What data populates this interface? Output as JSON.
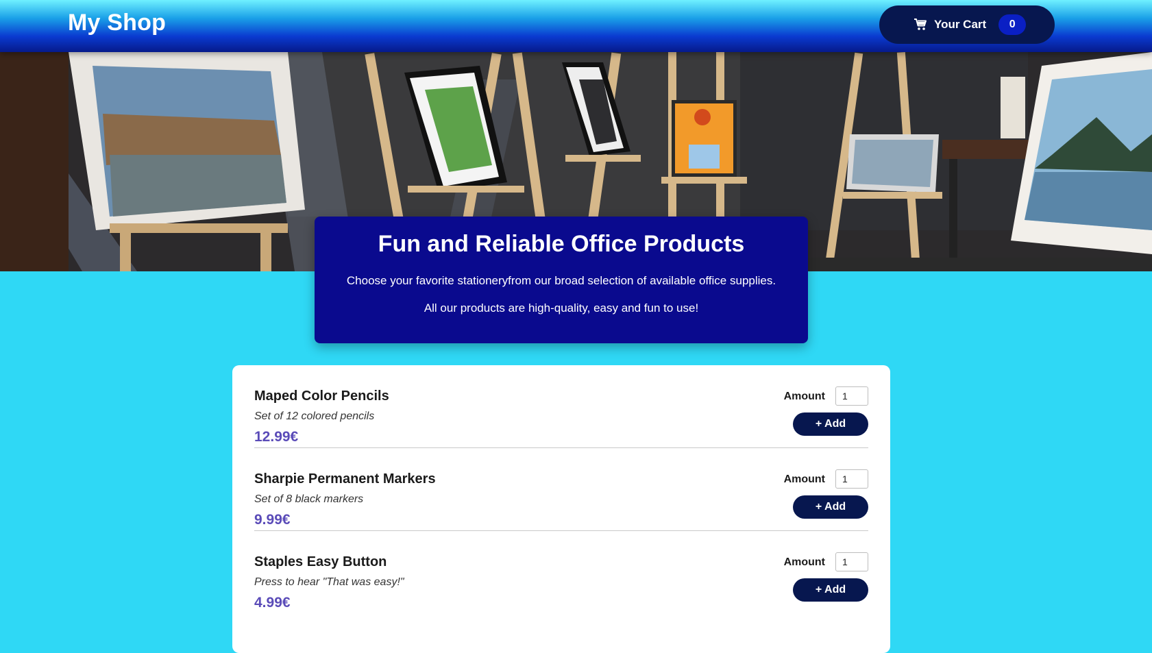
{
  "header": {
    "logo": "My Shop",
    "cart_label": "Your Cart",
    "cart_count": "0",
    "cart_icon": "shopping-cart-icon"
  },
  "hero": {
    "title": "Fun and Reliable Office Products",
    "line1": "Choose your favorite stationeryfrom our broad selection of available office supplies.",
    "line2": "All our products are high-quality, easy and fun to use!"
  },
  "products": [
    {
      "name": "Maped Color Pencils",
      "description": "Set of 12 colored pencils",
      "price": "12.99€",
      "amount_label": "Amount",
      "amount_value": "1",
      "add_label": "+ Add"
    },
    {
      "name": "Sharpie Permanent Markers",
      "description": "Set of 8 black markers",
      "price": "9.99€",
      "amount_label": "Amount",
      "amount_value": "1",
      "add_label": "+ Add"
    },
    {
      "name": "Staples Easy Button",
      "description": "Press to hear \"That was easy!\"",
      "price": "4.99€",
      "amount_label": "Amount",
      "amount_value": "1",
      "add_label": "+ Add"
    }
  ],
  "colors": {
    "page_background": "#2fd8f5",
    "header_dark": "#07174f",
    "hero_panel": "#0a0a8e",
    "price": "#5a4bb8",
    "cart_badge": "#0a1fc4"
  }
}
